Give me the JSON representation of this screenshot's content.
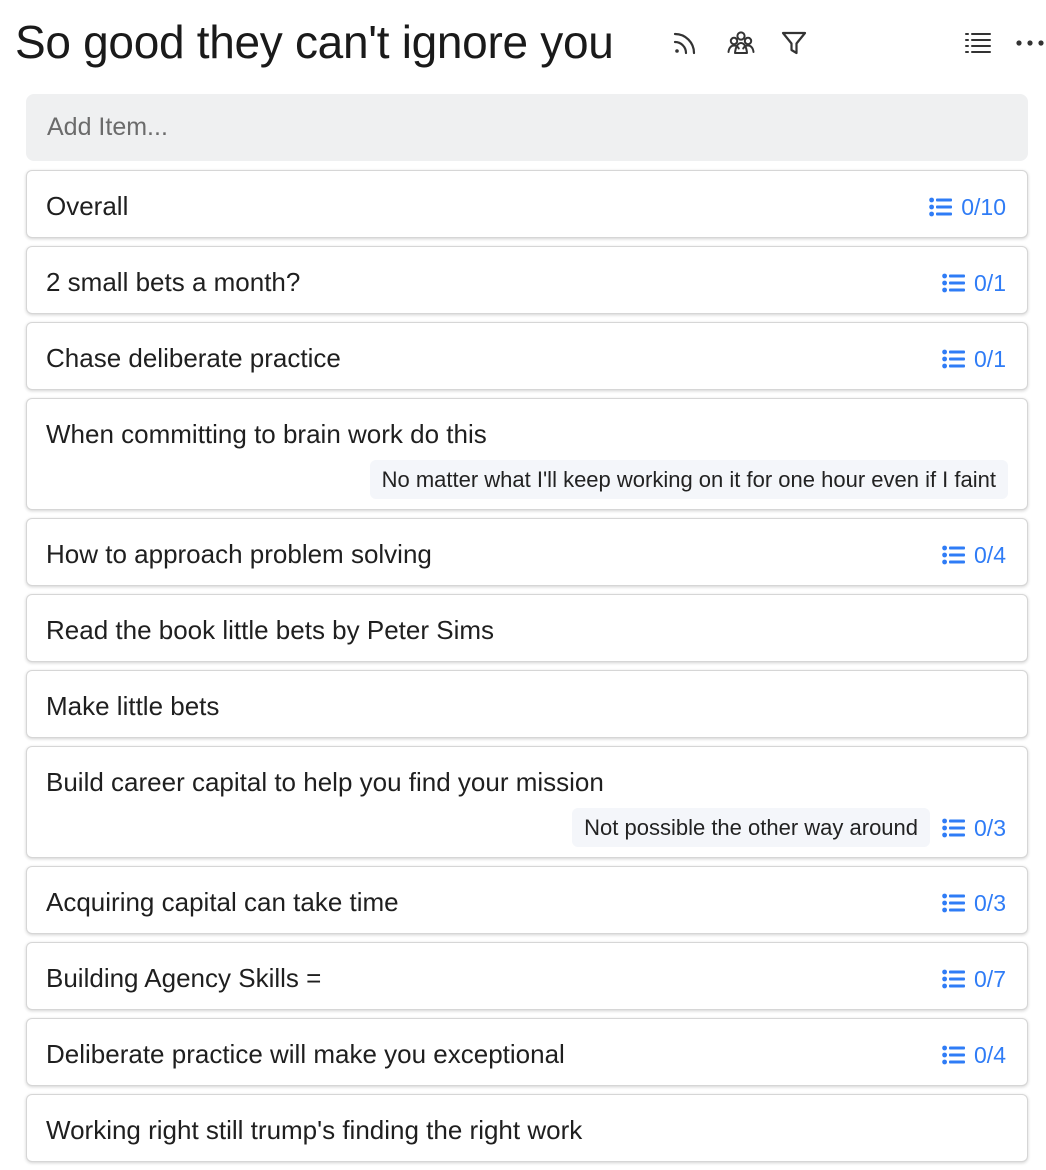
{
  "header": {
    "title": "So good they can't ignore you",
    "icons": [
      "rss-icon",
      "people-icon",
      "filter-icon",
      "list-view-icon",
      "more-icon"
    ]
  },
  "add_item": {
    "placeholder": "Add Item..."
  },
  "colors": {
    "accent": "#2f7cf6",
    "add_bar_bg": "#eff0f1",
    "note_bg": "#f4f6fa"
  },
  "items": [
    {
      "label": "Overall",
      "note": "",
      "count": "0/10"
    },
    {
      "label": "2 small bets a month?",
      "note": "",
      "count": "0/1"
    },
    {
      "label": "Chase deliberate practice",
      "note": "",
      "count": "0/1"
    },
    {
      "label": "When committing to brain work do this",
      "note": "No matter what I'll keep working on it for one hour even if I faint",
      "count": ""
    },
    {
      "label": "How to approach problem solving",
      "note": "",
      "count": "0/4"
    },
    {
      "label": "Read the book little bets by Peter Sims",
      "note": "",
      "count": ""
    },
    {
      "label": "Make little bets",
      "note": "",
      "count": ""
    },
    {
      "label": "Build career capital to help you find your mission",
      "note": "Not possible the other way around",
      "count": "0/3"
    },
    {
      "label": "Acquiring capital can take time",
      "note": "",
      "count": "0/3"
    },
    {
      "label": "Building Agency Skills =",
      "note": "",
      "count": "0/7"
    },
    {
      "label": "Deliberate practice will make you exceptional",
      "note": "",
      "count": "0/4"
    },
    {
      "label": "Working right still trump's finding the right work",
      "note": "",
      "count": ""
    }
  ]
}
